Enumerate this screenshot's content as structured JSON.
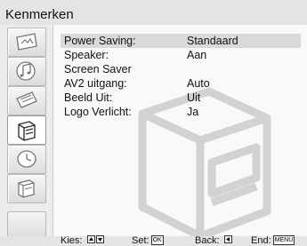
{
  "menu": {
    "title": "Kenmerken"
  },
  "sidebar": {
    "items": [
      {
        "icon": "picture-icon",
        "selected": false
      },
      {
        "icon": "sound-icon",
        "selected": false
      },
      {
        "icon": "channel-icon",
        "selected": false
      },
      {
        "icon": "features-icon",
        "selected": true
      },
      {
        "icon": "timer-icon",
        "selected": false
      },
      {
        "icon": "setup-icon",
        "selected": false
      }
    ]
  },
  "settings": [
    {
      "label": "Power Saving:",
      "value": "Standaard",
      "selected": true
    },
    {
      "label": "Speaker:",
      "value": "Aan",
      "selected": false
    },
    {
      "label": "Screen Saver",
      "value": "",
      "selected": false
    },
    {
      "label": "AV2 uitgang:",
      "value": "Auto",
      "selected": false
    },
    {
      "label": "Beeld Uit:",
      "value": "Uit",
      "selected": false
    },
    {
      "label": "Logo Verlicht:",
      "value": "Ja",
      "selected": false
    }
  ],
  "footer": {
    "select_label": "Kies:",
    "set_label": "Set:",
    "set_key": "OK",
    "back_label": "Back:",
    "end_label": "End:",
    "end_key": "MENU"
  },
  "colors": {
    "selection": "#d9d9d9",
    "panel": "#f9f9f9",
    "frame": "#e4e4e4"
  }
}
